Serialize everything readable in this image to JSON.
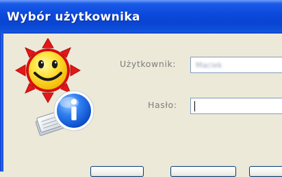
{
  "window": {
    "title": "Wybór użytkownika"
  },
  "form": {
    "user_label": "Użytkownik:",
    "user_value": "Maciek",
    "password_label": "Hasło:",
    "password_value": ""
  },
  "icons": {
    "app_icon": "sun-smiley-info-icon"
  },
  "colors": {
    "titlebar": "#0b48dc",
    "window_bg": "#ece9d8",
    "label_text": "#7d7d7d",
    "field_border": "#7f9db9"
  }
}
